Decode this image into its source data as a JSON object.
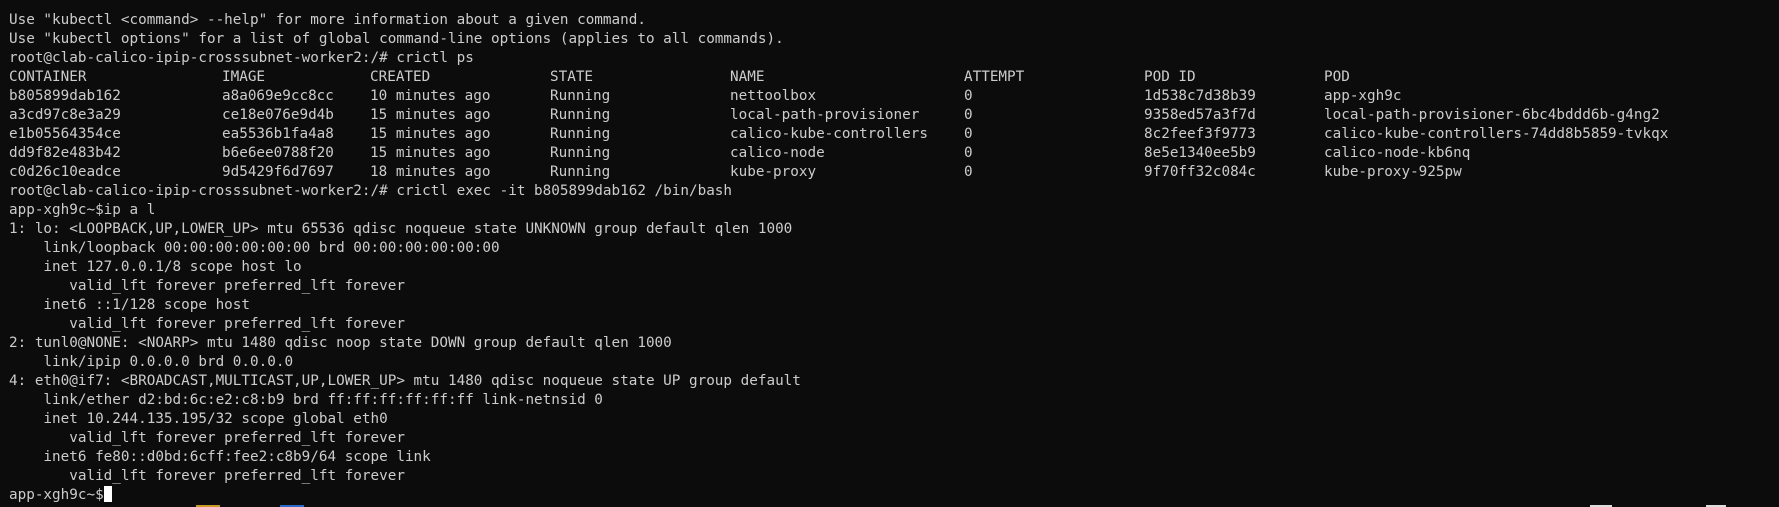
{
  "terminal": {
    "pre_lines": [
      "Use \"kubectl <command> --help\" for more information about a given command.",
      "Use \"kubectl options\" for a list of global command-line options (applies to all commands).",
      "root@clab-calico-ipip-crosssubnet-worker2:/# crictl ps"
    ],
    "table": {
      "headers": [
        "CONTAINER",
        "IMAGE",
        "CREATED",
        "STATE",
        "NAME",
        "ATTEMPT",
        "POD ID",
        "POD"
      ],
      "rows": [
        [
          "b805899dab162",
          "a8a069e9cc8cc",
          "10 minutes ago",
          "Running",
          "nettoolbox",
          "0",
          "1d538c7d38b39",
          "app-xgh9c"
        ],
        [
          "a3cd97c8e3a29",
          "ce18e076e9d4b",
          "15 minutes ago",
          "Running",
          "local-path-provisioner",
          "0",
          "9358ed57a3f7d",
          "local-path-provisioner-6bc4bddd6b-g4ng2"
        ],
        [
          "e1b05564354ce",
          "ea5536b1fa4a8",
          "15 minutes ago",
          "Running",
          "calico-kube-controllers",
          "0",
          "8c2feef3f9773",
          "calico-kube-controllers-74dd8b5859-tvkqx"
        ],
        [
          "dd9f82e483b42",
          "b6e6ee0788f20",
          "15 minutes ago",
          "Running",
          "calico-node",
          "0",
          "8e5e1340ee5b9",
          "calico-node-kb6nq"
        ],
        [
          "c0d26c10eadce",
          "9d5429f6d7697",
          "18 minutes ago",
          "Running",
          "kube-proxy",
          "0",
          "9f70ff32c084c",
          "kube-proxy-925pw"
        ]
      ]
    },
    "post_lines": [
      "root@clab-calico-ipip-crosssubnet-worker2:/# crictl exec -it b805899dab162 /bin/bash",
      "app-xgh9c~$ip a l",
      "1: lo: <LOOPBACK,UP,LOWER_UP> mtu 65536 qdisc noqueue state UNKNOWN group default qlen 1000",
      "    link/loopback 00:00:00:00:00:00 brd 00:00:00:00:00:00",
      "    inet 127.0.0.1/8 scope host lo",
      "       valid_lft forever preferred_lft forever",
      "    inet6 ::1/128 scope host",
      "       valid_lft forever preferred_lft forever",
      "2: tunl0@NONE: <NOARP> mtu 1480 qdisc noop state DOWN group default qlen 1000",
      "    link/ipip 0.0.0.0 brd 0.0.0.0",
      "4: eth0@if7: <BROADCAST,MULTICAST,UP,LOWER_UP> mtu 1480 qdisc noqueue state UP group default",
      "    link/ether d2:bd:6c:e2:c8:b9 brd ff:ff:ff:ff:ff:ff link-netnsid 0",
      "    inet 10.244.135.195/32 scope global eth0",
      "       valid_lft forever preferred_lft forever",
      "    inet6 fe80::d0bd:6cff:fee2:c8b9/64 scope link",
      "       valid_lft forever preferred_lft forever"
    ],
    "prompt": "app-xgh9c~$"
  },
  "colors": {
    "background": "#0c0c0c",
    "foreground": "#cccccc",
    "cursor": "#ffffff"
  }
}
